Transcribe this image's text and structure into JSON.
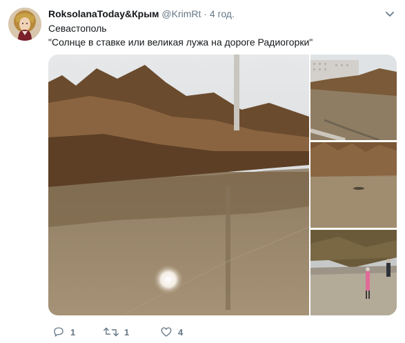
{
  "tweet": {
    "name": "RoksolanaToday&Крым",
    "handle": "@KrimRt",
    "separator": "·",
    "time": "4 год.",
    "lines": [
      "Севастополь",
      "\"Солнце в ставке или великая лужа на дороге Радиогорки\""
    ]
  },
  "actions": {
    "reply_count": "1",
    "retweet_count": "1",
    "like_count": "4"
  },
  "colors": {
    "name": "#14171a",
    "secondary": "#657786",
    "icon": "#657786"
  },
  "icons": [
    "avatar",
    "chevron-down-icon",
    "reply-icon",
    "retweet-icon",
    "like-icon"
  ]
}
